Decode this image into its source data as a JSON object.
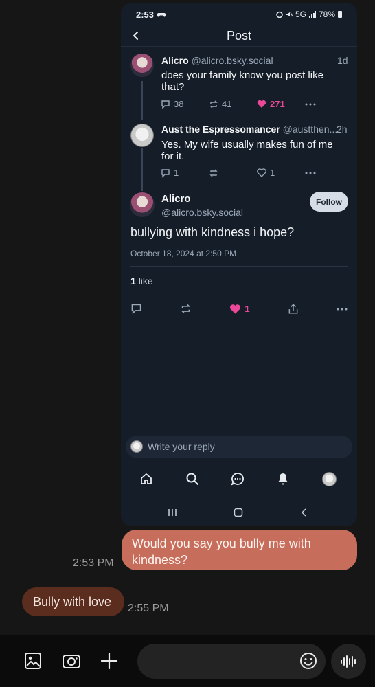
{
  "status_bar": {
    "time": "2:53",
    "network": "5G",
    "battery": "78%"
  },
  "header": {
    "title": "Post"
  },
  "thread": [
    {
      "name": "Alicro",
      "handle": "@alicro.bsky.social",
      "age": "1d",
      "text": "does your family know you post like that?",
      "replies": "38",
      "reposts": "41",
      "likes": "271"
    },
    {
      "name": "Aust the Espressomancer",
      "handle": "@austthen...",
      "age": "2h",
      "text": "Yes. My wife usually makes fun of me for it.",
      "replies": "1",
      "reposts": "",
      "likes": "1"
    }
  ],
  "main_post": {
    "name": "Alicro",
    "handle": "@alicro.bsky.social",
    "follow_label": "Follow",
    "text": "bullying with kindness i hope?",
    "date": "October 18, 2024 at 2:50 PM",
    "likes_count": "1",
    "likes_label": "like",
    "like_action_count": "1"
  },
  "reply_placeholder": "Write your reply",
  "chat": {
    "outgoing": {
      "text": "Would you say you bully me with kindness?",
      "time": "2:53 PM"
    },
    "incoming": {
      "text": "Bully with love",
      "time": "2:55 PM"
    }
  },
  "icons": {
    "back": "chevron-left-icon",
    "reply": "speech-bubble-icon",
    "repost": "repost-icon",
    "like": "heart-icon",
    "more": "more-icon",
    "share": "share-icon",
    "home": "home-icon",
    "search": "search-icon",
    "messages": "chat-icon",
    "notifications": "bell-icon",
    "gallery": "gallery-icon",
    "camera": "camera-icon",
    "add": "plus-icon",
    "emoji": "emoji-icon",
    "voice": "voice-icon"
  },
  "colors": {
    "background": "#161616",
    "card": "#151d28",
    "accent_like": "#ec4899",
    "bubble_out": "#c66d5b",
    "bubble_in": "#5b2d1f"
  }
}
